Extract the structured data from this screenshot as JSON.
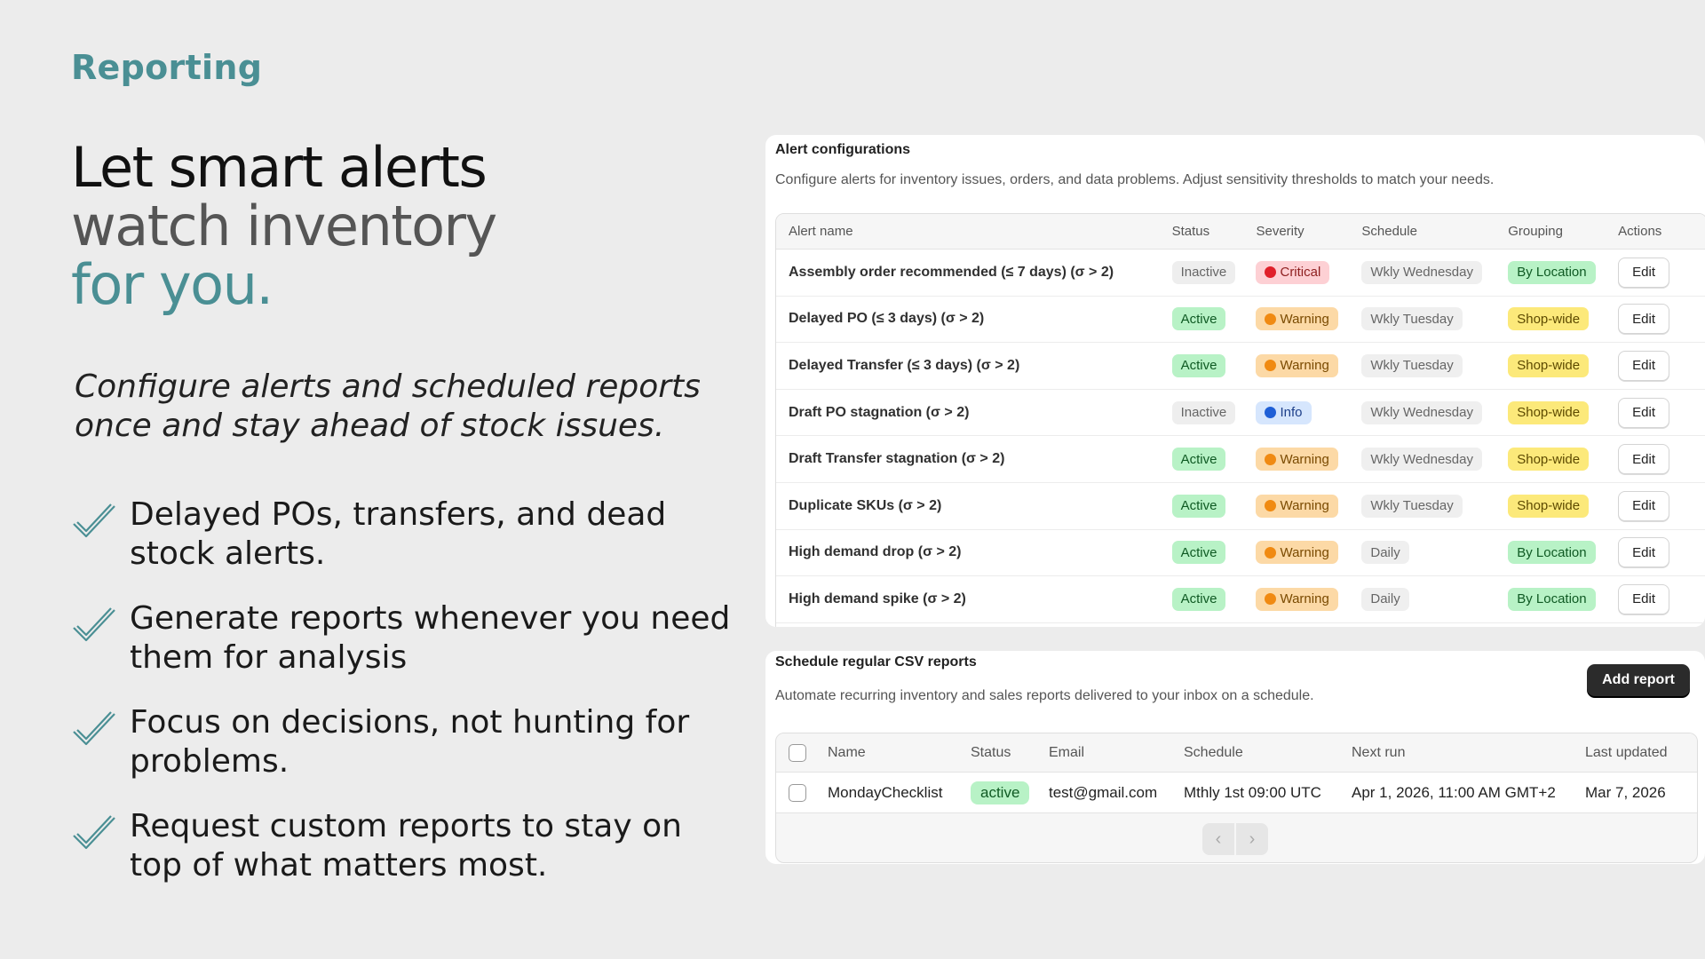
{
  "eyebrow": "Reporting",
  "headline": {
    "line1": "Let smart alerts",
    "line2": "watch inventory",
    "line3": "for you."
  },
  "subhead": "Configure alerts and scheduled reports once and stay ahead of stock issues.",
  "features": [
    "Delayed POs, transfers, and dead stock alerts.",
    "Generate reports whenever you need them for analysis",
    "Focus on decisions, not hunting for problems.",
    "Request custom reports to stay on top of what matters most."
  ],
  "alerts": {
    "title": "Alert configurations",
    "description": "Configure alerts for inventory issues, orders, and data problems. Adjust sensitivity thresholds to match your needs.",
    "columns": {
      "name": "Alert name",
      "status": "Status",
      "severity": "Severity",
      "schedule": "Schedule",
      "grouping": "Grouping",
      "actions": "Actions"
    },
    "rows": [
      {
        "name": "Assembly order recommended (≤ 7 days) (σ > 2)",
        "status": "Inactive",
        "severity": "Critical",
        "schedule": "Wkly Wednesday",
        "grouping": "By Location",
        "action": "Edit"
      },
      {
        "name": "Delayed PO (≤ 3 days) (σ > 2)",
        "status": "Active",
        "severity": "Warning",
        "schedule": "Wkly Tuesday",
        "grouping": "Shop-wide",
        "action": "Edit"
      },
      {
        "name": "Delayed Transfer (≤ 3 days) (σ > 2)",
        "status": "Active",
        "severity": "Warning",
        "schedule": "Wkly Tuesday",
        "grouping": "Shop-wide",
        "action": "Edit"
      },
      {
        "name": "Draft PO stagnation (σ > 2)",
        "status": "Inactive",
        "severity": "Info",
        "schedule": "Wkly Wednesday",
        "grouping": "Shop-wide",
        "action": "Edit"
      },
      {
        "name": "Draft Transfer stagnation (σ > 2)",
        "status": "Active",
        "severity": "Warning",
        "schedule": "Wkly Wednesday",
        "grouping": "Shop-wide",
        "action": "Edit"
      },
      {
        "name": "Duplicate SKUs (σ > 2)",
        "status": "Active",
        "severity": "Warning",
        "schedule": "Wkly Tuesday",
        "grouping": "Shop-wide",
        "action": "Edit"
      },
      {
        "name": "High demand drop (σ > 2)",
        "status": "Active",
        "severity": "Warning",
        "schedule": "Daily",
        "grouping": "By Location",
        "action": "Edit"
      },
      {
        "name": "High demand spike (σ > 2)",
        "status": "Active",
        "severity": "Warning",
        "schedule": "Daily",
        "grouping": "By Location",
        "action": "Edit"
      }
    ]
  },
  "reports": {
    "title": "Schedule regular CSV reports",
    "description": "Automate recurring inventory and sales reports delivered to your inbox on a schedule.",
    "add_label": "Add report",
    "columns": {
      "name": "Name",
      "status": "Status",
      "email": "Email",
      "schedule": "Schedule",
      "next_run": "Next run",
      "last_updated": "Last updated"
    },
    "rows": [
      {
        "name": "MondayChecklist",
        "status": "active",
        "email": "test@gmail.com",
        "schedule": "Mthly 1st 09:00 UTC",
        "next_run": "Apr 1, 2026, 11:00 AM GMT+2",
        "last_updated": "Mar 7, 2026"
      }
    ],
    "pager": {
      "prev": "‹",
      "next": "›"
    }
  },
  "colors": {
    "accent": "#4a8f94",
    "critical": "#e0202a",
    "warning": "#f08a12",
    "info": "#1f5fd6"
  }
}
